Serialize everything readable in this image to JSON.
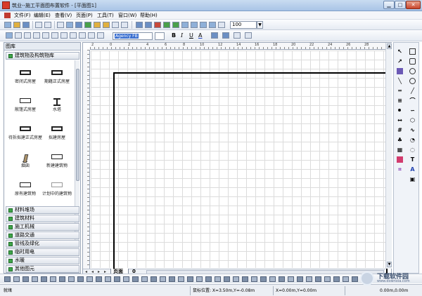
{
  "window": {
    "title": "筑业--施工平面图布置软件 - [平面图1]"
  },
  "menu": {
    "items": [
      "文件(F)",
      "编辑(E)",
      "查看(V)",
      "页面(P)",
      "工具(T)",
      "窗口(W)",
      "帮助(H)"
    ]
  },
  "toolbar": {
    "zoom_value": "100",
    "font_name": "Agency FB",
    "bold_label": "B",
    "italic_label": "I",
    "underline_label": "U",
    "font_color_label": "A"
  },
  "library": {
    "title": "图库",
    "active_category": "建筑物及构筑物库",
    "shapes": [
      {
        "label": "密闭式房屋",
        "style": "thick"
      },
      {
        "label": "期籍正式房屋",
        "style": "thick"
      },
      {
        "label": "敞篷式房屋",
        "style": "normal"
      },
      {
        "label": "水塔",
        "style": "ibeam"
      },
      {
        "label": "待拆拟建正式房屋",
        "style": "thick"
      },
      {
        "label": "拟建房屋",
        "style": "thick"
      },
      {
        "label": "烟囱",
        "style": "tower"
      },
      {
        "label": "新建建筑物",
        "style": "normal"
      },
      {
        "label": "原有建筑物",
        "style": "normal"
      },
      {
        "label": "计划中的建筑物",
        "style": "dim"
      }
    ],
    "categories": [
      "材料堆场",
      "建筑材料",
      "施工机械",
      "道路交通",
      "管线及绿化",
      "临时用电",
      "水暖",
      "其他图元"
    ]
  },
  "canvas": {
    "ruler_numbers": [
      "2",
      "0",
      "2",
      "4",
      "6",
      "8",
      "10",
      "12",
      "14",
      "16",
      "18",
      "20",
      "22",
      "24",
      "26",
      "28"
    ],
    "page_tab_label": "页面",
    "page_number": "0"
  },
  "palette": {
    "text_tool_label": "T",
    "font_tool_label": "A"
  },
  "status": {
    "ready": "就绪",
    "mouse_position": "鼠标位置: X=3.50m,Y=-0.08m",
    "origin": "X=0.00m,Y=0.00m",
    "size": "0.00m,0.00m"
  },
  "watermark": {
    "name": "下载软件园",
    "sub": "www.downxia.com"
  }
}
